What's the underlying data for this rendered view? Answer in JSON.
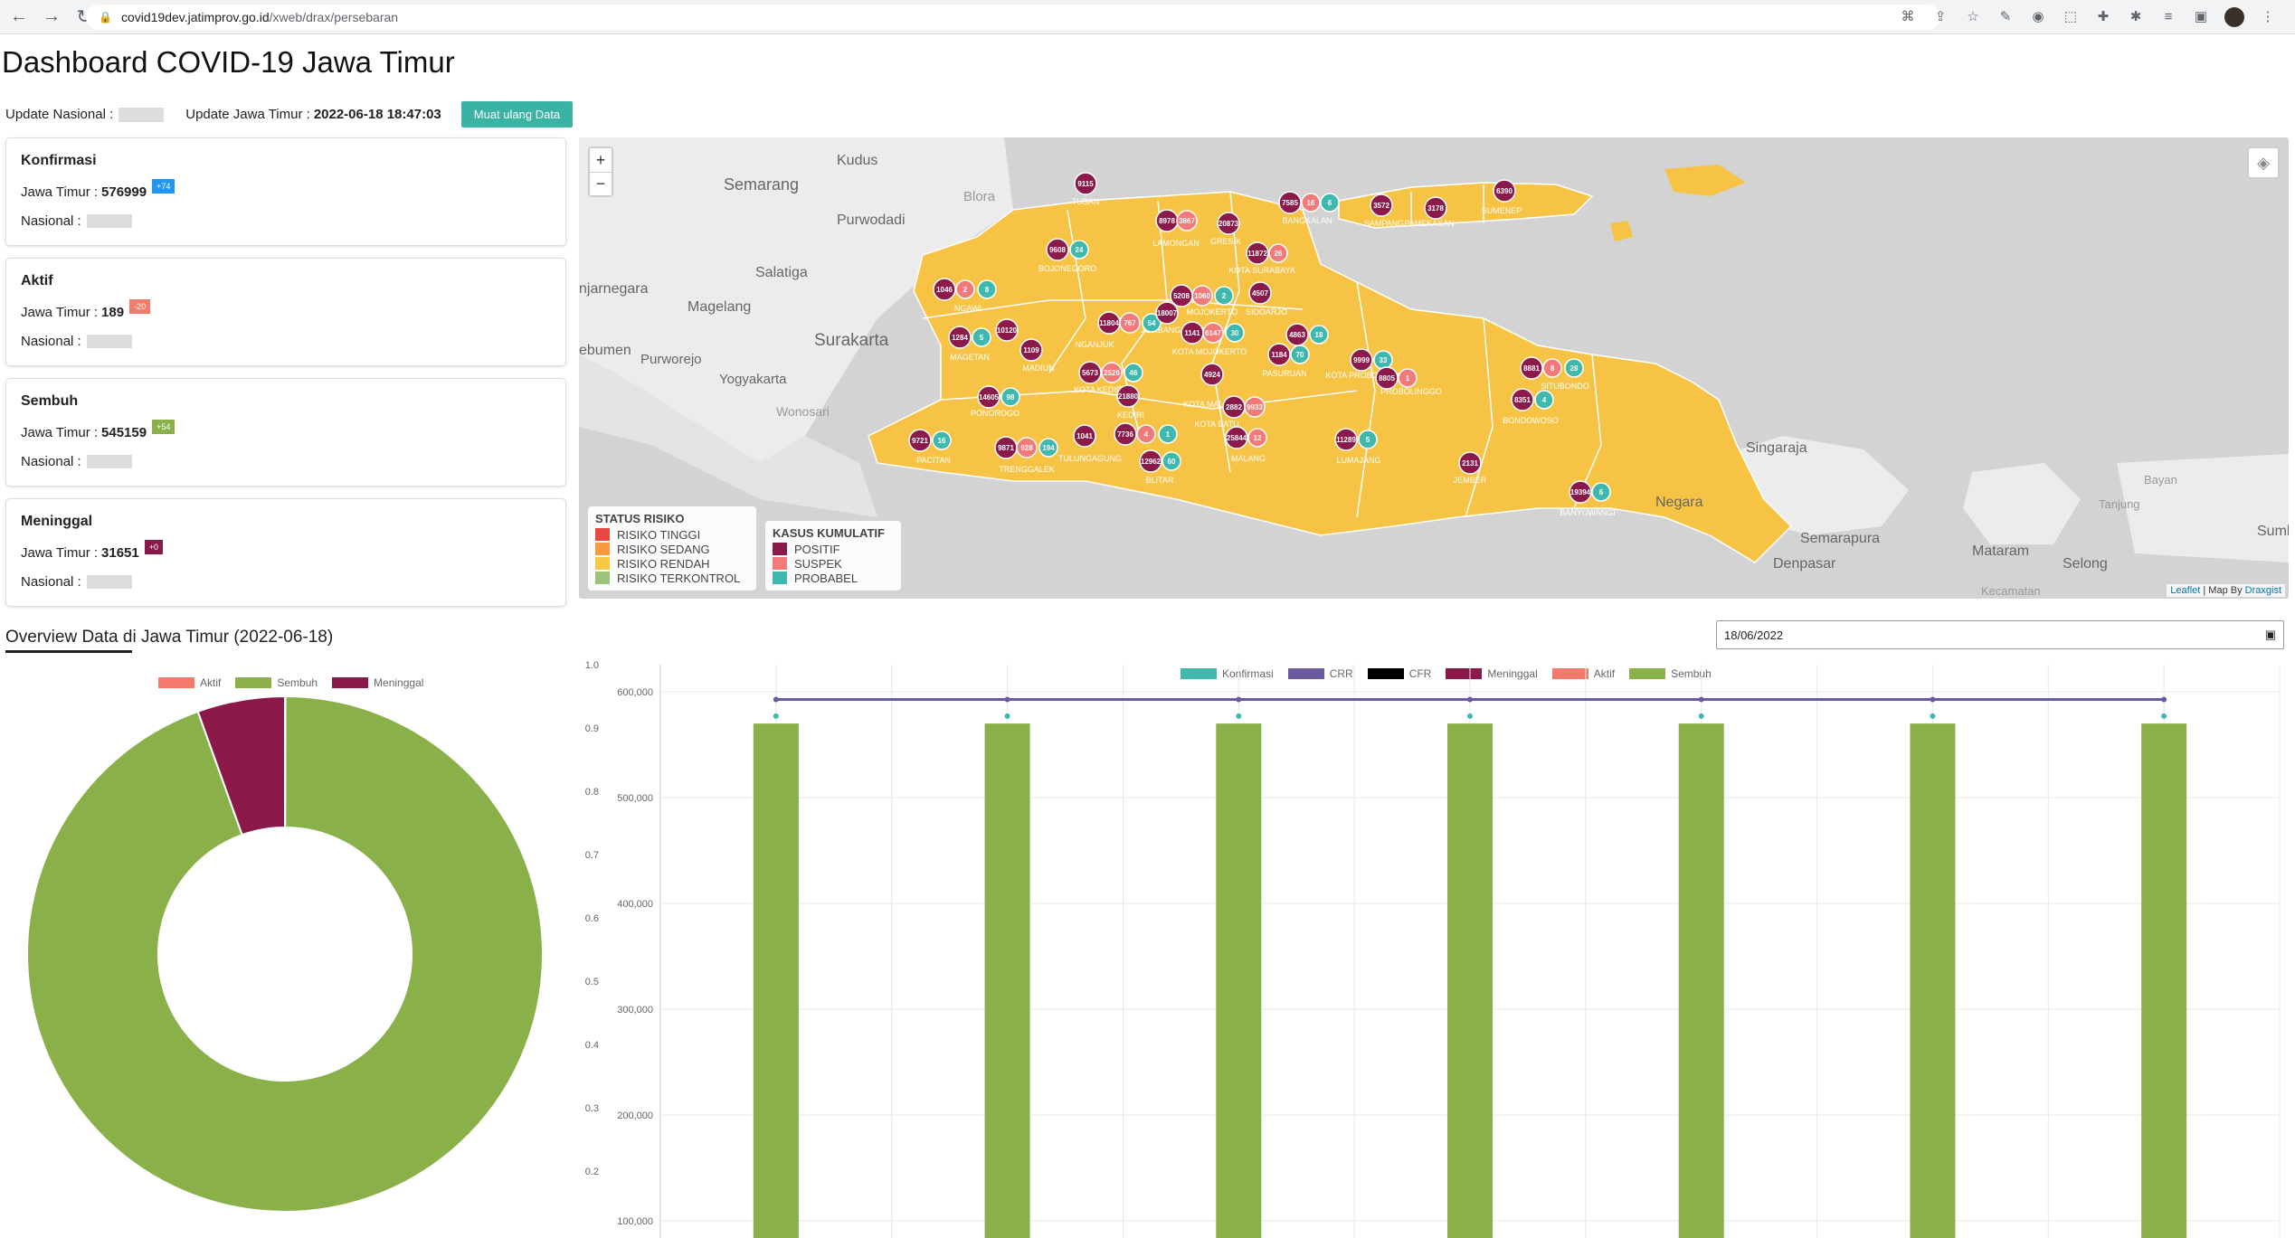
{
  "browser": {
    "url_host": "covid19dev.jatimprov.go.id",
    "url_path": "/xweb/drax/persebaran"
  },
  "page": {
    "title": "Dashboard COVID-19 Jawa Timur",
    "update_nasional_label": "Update Nasional :",
    "update_jatim_label": "Update Jawa Timur :",
    "update_jatim_value": "2022-06-18 18:47:03",
    "reload_label": "Muat ulang Data"
  },
  "cards": [
    {
      "title": "Konfirmasi",
      "jatim_label": "Jawa Timur :",
      "jatim_value": "576999",
      "badge": "+74",
      "badge_color": "#2196f3",
      "nasional_label": "Nasional :"
    },
    {
      "title": "Aktif",
      "jatim_label": "Jawa Timur :",
      "jatim_value": "189",
      "badge": "-20",
      "badge_color": "#f47a6b",
      "nasional_label": "Nasional :"
    },
    {
      "title": "Sembuh",
      "jatim_label": "Jawa Timur :",
      "jatim_value": "545159",
      "badge": "+54",
      "badge_color": "#8ab04a",
      "nasional_label": "Nasional :"
    },
    {
      "title": "Meninggal",
      "jatim_label": "Jawa Timur :",
      "jatim_value": "31651",
      "badge": "+0",
      "badge_color": "#8b1a4a",
      "nasional_label": "Nasional :"
    }
  ],
  "map": {
    "zoom_in": "+",
    "zoom_out": "−",
    "place_labels": [
      "Kudus",
      "Semarang",
      "Blora",
      "Purwodadi",
      "Salatiga",
      "Magelang",
      "Surakarta",
      "Purworejo",
      "Yogyakarta",
      "Wonosari",
      "njarnegara",
      "ebumen",
      "Singaraja",
      "Negara",
      "Semarapura",
      "Denpasar",
      "Mataram",
      "Selong",
      "Bayan",
      "Tanjung",
      "Sumbaw",
      "Kecamatan",
      "Tanjung"
    ],
    "markers": [
      {
        "label": "9115",
        "kind": "positif"
      },
      {
        "label": "8978",
        "kind": "positif"
      },
      {
        "label": "3867",
        "kind": "suspek"
      },
      {
        "label": "20873",
        "kind": "positif"
      },
      {
        "label": "7585",
        "kind": "positif"
      },
      {
        "label": "16",
        "kind": "suspek"
      },
      {
        "label": "6",
        "kind": "probabel"
      },
      {
        "label": "3572",
        "kind": "positif"
      },
      {
        "label": "3178",
        "kind": "positif"
      },
      {
        "label": "6390",
        "kind": "positif"
      },
      {
        "label": "9608",
        "kind": "positif"
      },
      {
        "label": "24",
        "kind": "probabel"
      },
      {
        "label": "11872",
        "kind": "positif"
      },
      {
        "label": "26",
        "kind": "suspek"
      },
      {
        "label": "1046",
        "kind": "positif"
      },
      {
        "label": "2",
        "kind": "suspek"
      },
      {
        "label": "8",
        "kind": "probabel"
      },
      {
        "label": "5208",
        "kind": "positif"
      },
      {
        "label": "1060",
        "kind": "suspek"
      },
      {
        "label": "2",
        "kind": "probabel"
      },
      {
        "label": "4507",
        "kind": "positif"
      },
      {
        "label": "11804",
        "kind": "positif"
      },
      {
        "label": "767",
        "kind": "suspek"
      },
      {
        "label": "54",
        "kind": "probabel"
      },
      {
        "label": "18007",
        "kind": "positif"
      },
      {
        "label": "1284",
        "kind": "positif"
      },
      {
        "label": "5",
        "kind": "probabel"
      },
      {
        "label": "10120",
        "kind": "positif"
      },
      {
        "label": "1109",
        "kind": "positif"
      },
      {
        "label": "1141",
        "kind": "positif"
      },
      {
        "label": "6147",
        "kind": "suspek"
      },
      {
        "label": "30",
        "kind": "probabel"
      },
      {
        "label": "4863",
        "kind": "positif"
      },
      {
        "label": "18",
        "kind": "probabel"
      },
      {
        "label": "1184",
        "kind": "positif"
      },
      {
        "label": "70",
        "kind": "probabel"
      },
      {
        "label": "9999",
        "kind": "positif"
      },
      {
        "label": "33",
        "kind": "probabel"
      },
      {
        "label": "8805",
        "kind": "positif"
      },
      {
        "label": "1",
        "kind": "suspek"
      },
      {
        "label": "5673",
        "kind": "positif"
      },
      {
        "label": "2526",
        "kind": "suspek"
      },
      {
        "label": "46",
        "kind": "probabel"
      },
      {
        "label": "4924",
        "kind": "positif"
      },
      {
        "label": "8881",
        "kind": "positif"
      },
      {
        "label": "8",
        "kind": "suspek"
      },
      {
        "label": "28",
        "kind": "probabel"
      },
      {
        "label": "14605",
        "kind": "positif"
      },
      {
        "label": "98",
        "kind": "probabel"
      },
      {
        "label": "21880",
        "kind": "positif"
      },
      {
        "label": "2882",
        "kind": "positif"
      },
      {
        "label": "9933",
        "kind": "suspek"
      },
      {
        "label": "8351",
        "kind": "positif"
      },
      {
        "label": "4",
        "kind": "probabel"
      },
      {
        "label": "9721",
        "kind": "positif"
      },
      {
        "label": "16",
        "kind": "probabel"
      },
      {
        "label": "9871",
        "kind": "positif"
      },
      {
        "label": "928",
        "kind": "suspek"
      },
      {
        "label": "194",
        "kind": "probabel"
      },
      {
        "label": "1041",
        "kind": "positif"
      },
      {
        "label": "7736",
        "kind": "positif"
      },
      {
        "label": "4",
        "kind": "suspek"
      },
      {
        "label": "1",
        "kind": "probabel"
      },
      {
        "label": "25844",
        "kind": "positif"
      },
      {
        "label": "12",
        "kind": "suspek"
      },
      {
        "label": "11289",
        "kind": "positif"
      },
      {
        "label": "5",
        "kind": "probabel"
      },
      {
        "label": "12962",
        "kind": "positif"
      },
      {
        "label": "60",
        "kind": "probabel"
      },
      {
        "label": "2131",
        "kind": "positif"
      },
      {
        "label": "19394",
        "kind": "positif"
      },
      {
        "label": "6",
        "kind": "probabel"
      }
    ],
    "region_labels": [
      "TUBAN",
      "LAMONGAN",
      "GRESIK",
      "BANGKALAN",
      "SAMPANG",
      "PAMEKASAN",
      "SUMENEP",
      "BOJONEGORO",
      "KOTA SURABAYA",
      "NGAWI",
      "MOJOKERTO",
      "SIDOARJO",
      "NGANJUK",
      "JOMBANG",
      "MAGETAN",
      "MADIUN",
      "KOTA MOJOKERTO",
      "PASURUAN",
      "KOTA PROBOLINGGO",
      "PROBOLINGGO",
      "KOTA KEDIRI",
      "KEDIRI",
      "KOTA MALANG",
      "SITUBONDO",
      "PONOROGO",
      "KOTA BATU",
      "BONDOWOSO",
      "PACITAN",
      "TRENGGALEK",
      "TULUNGAGUNG",
      "BLITAR",
      "MALANG",
      "LUMAJANG",
      "JEMBER",
      "BANYUWANGI",
      "KOTA MADIUN",
      "KOTA PASURUAN",
      "KOTA BLITAR"
    ],
    "legend_status": {
      "title": "STATUS RISIKO",
      "items": [
        {
          "label": "RISIKO TINGGI",
          "color": "#e8483d"
        },
        {
          "label": "RISIKO SEDANG",
          "color": "#f59a3e"
        },
        {
          "label": "RISIKO RENDAH",
          "color": "#f7c844"
        },
        {
          "label": "RISIKO TERKONTROL",
          "color": "#9bc47a"
        }
      ]
    },
    "legend_kasus": {
      "title": "KASUS KUMULATIF",
      "items": [
        {
          "label": "POSITIF",
          "color": "#8b1a4a"
        },
        {
          "label": "SUSPEK",
          "color": "#f47a7a"
        },
        {
          "label": "PROBABEL",
          "color": "#3fb8ae"
        }
      ]
    },
    "attribution_leaflet": "Leaflet",
    "attribution_mid": " | Map By ",
    "attribution_draxgist": "Draxgist"
  },
  "overview": {
    "title": "Overview Data di Jawa Timur (2022-06-18)",
    "date_value": "18/06/2022"
  },
  "chart_data": [
    {
      "type": "pie",
      "variant": "doughnut",
      "legend": [
        "Aktif",
        "Sembuh",
        "Meninggal"
      ],
      "values": [
        189,
        545159,
        31651
      ],
      "colors": [
        "#f47a6b",
        "#8ab04a",
        "#8b1a4a"
      ],
      "legend_position": "top"
    },
    {
      "type": "bar",
      "legend": [
        {
          "name": "Konfirmasi",
          "color": "#3fb8ae"
        },
        {
          "name": "CRR",
          "color": "#6b5aa0"
        },
        {
          "name": "CFR",
          "color": "#000000"
        },
        {
          "name": "Meninggal",
          "color": "#8b1a4a"
        },
        {
          "name": "Aktif",
          "color": "#f47a6b"
        },
        {
          "name": "Sembuh",
          "color": "#8ab04a"
        }
      ],
      "categories": [
        "",
        "",
        "",
        "",
        "",
        "",
        ""
      ],
      "series": [
        {
          "name": "Sembuh",
          "values": [
            570000,
            570000,
            570000,
            570000,
            570000,
            570000,
            570000
          ],
          "axis": "y"
        },
        {
          "name": "Konfirmasi",
          "values": [
            577000,
            577000,
            577000,
            577000,
            577000,
            577000,
            577000
          ],
          "axis": "y"
        },
        {
          "name": "CRR",
          "values": [
            0.945,
            0.945,
            0.945,
            0.945,
            0.945,
            0.945,
            0.945
          ],
          "axis": "y1"
        }
      ],
      "y_ticks": [
        "600,000",
        "500,000",
        "400,000",
        "300,000",
        "200,000",
        "100,000"
      ],
      "y1_ticks": [
        "1.0",
        "0.9",
        "0.8",
        "0.7",
        "0.6",
        "0.5",
        "0.4",
        "0.3",
        "0.2"
      ],
      "ylim": [
        0,
        600000
      ],
      "y1lim": [
        0,
        1.0
      ],
      "grid": true,
      "legend_position": "top"
    }
  ]
}
